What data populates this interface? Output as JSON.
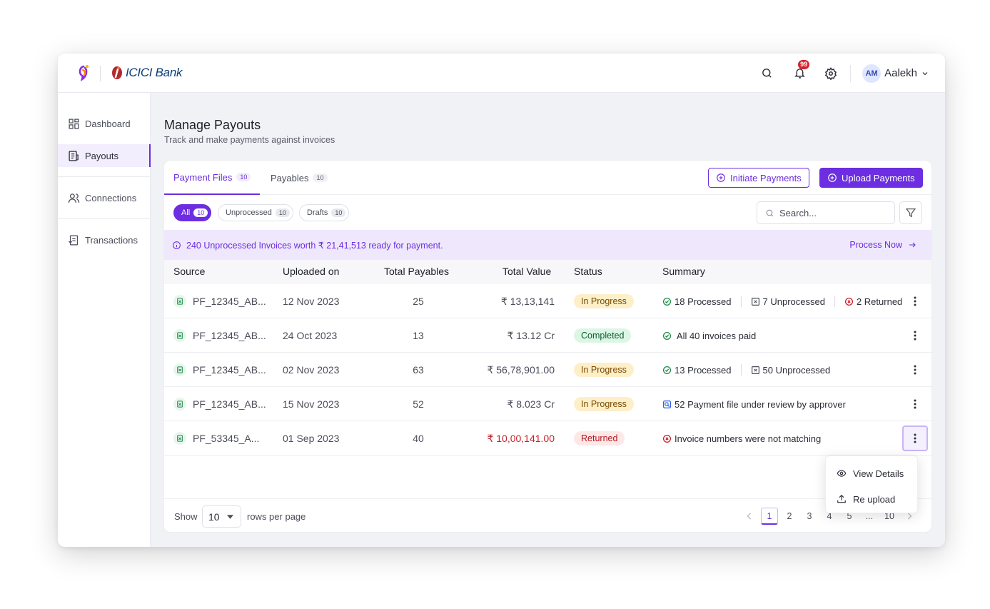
{
  "header": {
    "bank_name": "ICICI Bank",
    "notifications_count": "99",
    "user_initials": "AM",
    "user_name": "Aalekh"
  },
  "sidebar": {
    "items": [
      {
        "label": "Dashboard",
        "icon": "dashboard-icon"
      },
      {
        "label": "Payouts",
        "icon": "payouts-icon",
        "active": true
      },
      {
        "label": "Connections",
        "icon": "connections-icon"
      },
      {
        "label": "Transactions",
        "icon": "transactions-icon"
      }
    ]
  },
  "page": {
    "title": "Manage Payouts",
    "subtitle": "Track and make payments against invoices"
  },
  "tabs": [
    {
      "label": "Payment Files",
      "count": "10",
      "active": true
    },
    {
      "label": "Payables",
      "count": "10"
    }
  ],
  "actions": {
    "initiate_label": "Initiate Payments",
    "upload_label": "Upload Payments"
  },
  "filters": [
    {
      "label": "All",
      "count": "10",
      "active": true
    },
    {
      "label": "Unprocessed",
      "count": "10"
    },
    {
      "label": "Drafts",
      "count": "10"
    }
  ],
  "search": {
    "placeholder": "Search..."
  },
  "banner": {
    "text": "240 Unprocessed Invoices worth ₹ 21,41,513 ready for payment.",
    "action": "Process Now"
  },
  "table": {
    "columns": [
      "Source",
      "Uploaded on",
      "Total Payables",
      "Total Value",
      "Status",
      "Summary"
    ],
    "rows": [
      {
        "source": "PF_12345_AB...",
        "uploaded": "12 Nov 2023",
        "payables": "25",
        "value": "₹ 13,13,141",
        "status": "In Progress",
        "summary": [
          {
            "icon": "check-circle-icon",
            "text": "18 Processed"
          },
          {
            "icon": "x-square-icon",
            "text": "7 Unprocessed"
          },
          {
            "icon": "x-circle-icon",
            "text": "2 Returned"
          }
        ]
      },
      {
        "source": "PF_12345_AB...",
        "uploaded": "24 Oct 2023",
        "payables": "13",
        "value": "₹ 13.12 Cr",
        "status": "Completed",
        "summary": [
          {
            "icon": "check-circle-icon",
            "text": " All 40 invoices paid"
          }
        ]
      },
      {
        "source": "PF_12345_AB...",
        "uploaded": "02 Nov 2023",
        "payables": "63",
        "value": "₹ 56,78,901.00",
        "status": "In Progress",
        "summary": [
          {
            "icon": "check-circle-icon",
            "text": "13 Processed"
          },
          {
            "icon": "x-square-icon",
            "text": "50 Unprocessed"
          }
        ]
      },
      {
        "source": "PF_12345_AB...",
        "uploaded": "15 Nov 2023",
        "payables": "52",
        "value": "₹ 8.023 Cr",
        "status": "In Progress",
        "summary": [
          {
            "icon": "review-icon",
            "text": "52 Payment file under review by approver"
          }
        ]
      },
      {
        "source": "PF_53345_A...",
        "uploaded": "01 Sep 2023",
        "payables": "40",
        "value": "₹ 10,00,141.00",
        "status": "Returned",
        "summary": [
          {
            "icon": "x-circle-icon",
            "text": "Invoice numbers were not matching"
          }
        ]
      }
    ]
  },
  "row_menu": {
    "items": [
      {
        "label": "View Details",
        "icon": "eye-icon"
      },
      {
        "label": "Re upload",
        "icon": "upload-icon"
      }
    ]
  },
  "pagination": {
    "show_label": "Show",
    "rows_per_page": "10",
    "rows_label": "rows per page",
    "pages": [
      "1",
      "2",
      "3",
      "4",
      "5",
      "...",
      "10"
    ],
    "current_page": "1"
  },
  "colors": {
    "accent": "#6c2ee0",
    "in_progress_bg": "#fdefc8",
    "completed_bg": "#dcf6e6",
    "returned_bg": "#fde8e8",
    "error": "#c8202a",
    "success": "#1a8a45"
  }
}
